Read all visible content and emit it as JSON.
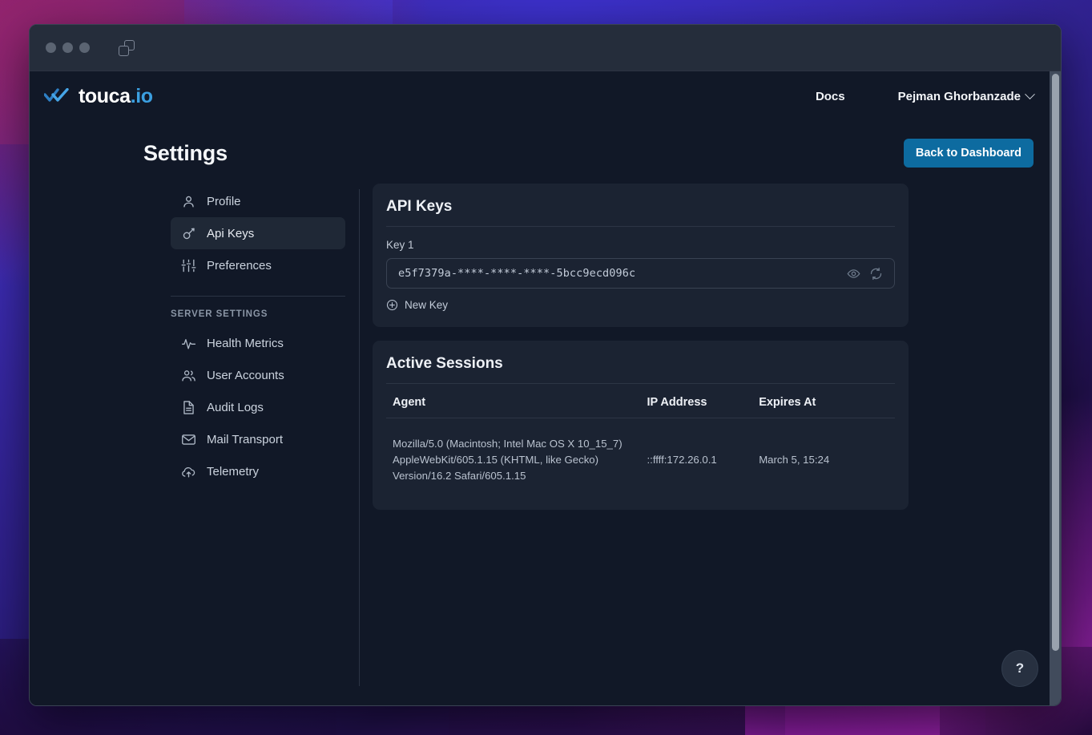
{
  "window": {
    "traffic_lights": [
      "close",
      "minimize",
      "zoom"
    ],
    "tabs_icon": "copy-tabs-icon"
  },
  "navbar": {
    "logo_text_main": "touca",
    "logo_text_accent": ".io",
    "logo_icon": "touca-checkmarks-logo",
    "docs_label": "Docs",
    "user_name": "Pejman Ghorbanzade"
  },
  "header": {
    "title": "Settings",
    "back_button_label": "Back to Dashboard",
    "accent_color": "#0d6ba0"
  },
  "sidebar": {
    "items": [
      {
        "label": "Profile",
        "icon": "user-icon",
        "active": false
      },
      {
        "label": "Api Keys",
        "icon": "key-icon",
        "active": true
      },
      {
        "label": "Preferences",
        "icon": "sliders-icon",
        "active": false
      }
    ],
    "group_label": "SERVER SETTINGS",
    "server_items": [
      {
        "label": "Health Metrics",
        "icon": "activity-icon"
      },
      {
        "label": "User Accounts",
        "icon": "users-icon"
      },
      {
        "label": "Audit Logs",
        "icon": "document-icon"
      },
      {
        "label": "Mail Transport",
        "icon": "envelope-icon"
      },
      {
        "label": "Telemetry",
        "icon": "cloud-upload-icon"
      }
    ]
  },
  "api_keys": {
    "card_title": "API Keys",
    "key_label": "Key 1",
    "key_value": "e5f7379a-****-****-****-5bcc9ecd096c",
    "reveal_icon": "eye-icon",
    "regenerate_icon": "refresh-icon",
    "new_key_label": "New Key",
    "new_key_icon": "plus-circle-icon"
  },
  "active_sessions": {
    "card_title": "Active Sessions",
    "columns": [
      "Agent",
      "IP Address",
      "Expires At"
    ],
    "rows": [
      {
        "agent": "Mozilla/5.0 (Macintosh; Intel Mac OS X 10_15_7) AppleWebKit/605.1.15 (KHTML, like Gecko) Version/16.2 Safari/605.1.15",
        "ip": "::ffff:172.26.0.1",
        "expires": "March 5, 15:24"
      }
    ]
  },
  "help": {
    "label": "?",
    "icon": "question-mark-icon"
  }
}
